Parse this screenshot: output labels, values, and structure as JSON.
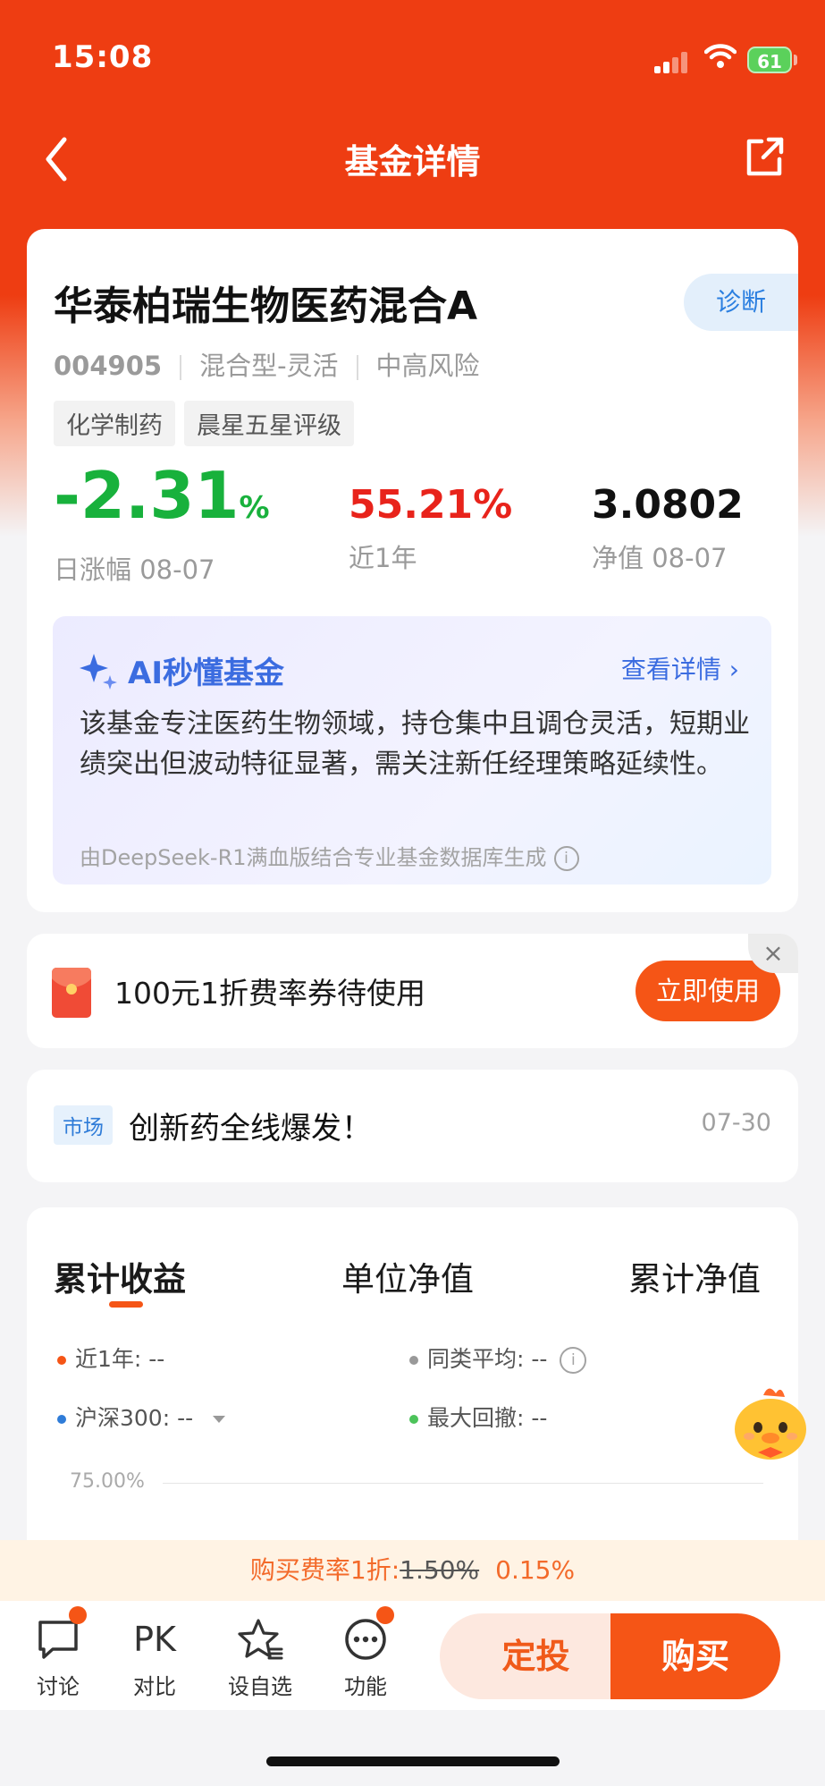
{
  "status_bar": {
    "time": "15:08",
    "battery": "61"
  },
  "nav": {
    "title": "基金详情",
    "back_icon": "chevron-left-icon",
    "share_icon": "share-icon"
  },
  "fund": {
    "name": "华泰柏瑞生物医药混合A",
    "diagnose_label": "诊断",
    "code": "004905",
    "type": "混合型-灵活",
    "risk": "中高风险",
    "tags": [
      "化学制药",
      "晨星五星评级"
    ],
    "daily_change": {
      "value": "-2.31",
      "unit": "%",
      "label": "日涨幅 08-07"
    },
    "year_return": {
      "value": "55.21%",
      "label": "近1年"
    },
    "nav": {
      "value": "3.0802",
      "label": "净值 08-07"
    },
    "colors": {
      "down": "#18b13c",
      "up": "#e8231b"
    }
  },
  "ai": {
    "title": "AI秒懂基金",
    "more": "查看详情",
    "text": "该基金专注医药生物领域，持仓集中且调仓灵活，短期业绩突出但波动特征显著，需关注新任经理策略延续性。",
    "footer": "由DeepSeek-R1满血版结合专业基金数据库生成"
  },
  "coupon": {
    "text": "100元1折费率券待使用",
    "button": "立即使用",
    "close": "×"
  },
  "news": {
    "badge": "市场",
    "title": "创新药全线爆发！",
    "date": "07-30"
  },
  "chart": {
    "tabs": [
      "累计收益",
      "单位净值",
      "累计净值"
    ],
    "active_tab": 0,
    "legend": [
      {
        "label": "近1年: --",
        "color": "#f55516"
      },
      {
        "label": "同类平均: --",
        "color": "#999999"
      },
      {
        "label": "沪深300: --",
        "color": "#2f7cd8"
      },
      {
        "label": "最大回撤: --",
        "color": "#4cc35a"
      }
    ],
    "y_tick": "75.00%"
  },
  "fee": {
    "prefix": "购买费率1折:",
    "old": "1.50%",
    "new": "0.15%"
  },
  "bottom": {
    "discuss": "讨论",
    "pk_icon_text": "PK",
    "pk": "对比",
    "watchlist": "设自选",
    "functions": "功能",
    "dingtou": "定投",
    "buy": "购买"
  },
  "accent_color": "#f55516",
  "header_color": "#ee3d12"
}
